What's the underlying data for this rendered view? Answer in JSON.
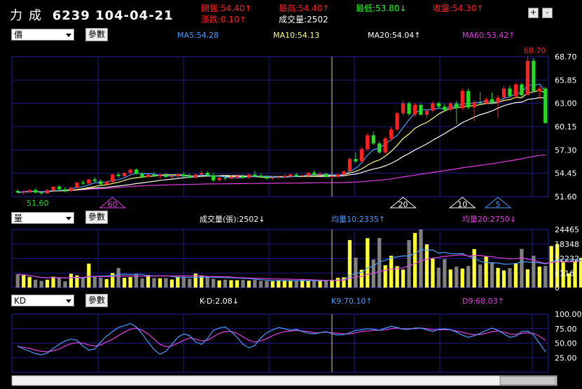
{
  "header": {
    "company": "力成",
    "code_date": "6239 104-04-21",
    "open": "開盤:54.40↑",
    "change": "漲跌:0.10↑",
    "high": "最高:54.40↑",
    "volume": "成交量:2502",
    "low": "最低:53.80↓",
    "close": "收盤:54.30↑",
    "zoom_in": "+",
    "zoom_out": "-"
  },
  "price_panel": {
    "select": "價",
    "button": "參數",
    "ma5": "MA5:54.28",
    "ma10": "MA10:54.13",
    "ma20": "MA20:54.04↑",
    "ma60": "MA60:53.42↑",
    "high_label": "68.70",
    "low_label": "51.60",
    "markers": [
      "60",
      "20",
      "10",
      "5"
    ]
  },
  "volume_panel": {
    "select": "量",
    "button": "參數",
    "vol": "成交量(張):2502↓",
    "avg10": "均量10:2335↑",
    "avg20": "均量20:2750↓"
  },
  "kd_panel": {
    "select": "KD",
    "button": "參數",
    "kd": "K-D:2.08↓",
    "k9": "K9:70.10↑",
    "d9": "D9:68.03↑"
  },
  "colors": {
    "up": "#ff2020",
    "down": "#22dd22",
    "ma5": "#4a9cff",
    "ma10": "#ffff80",
    "ma20": "#ffffff",
    "ma60": "#e040e0",
    "vol_up": "#ffff33",
    "vol_down": "#808080",
    "grid": "#1b1b8a"
  },
  "chart_data": [
    {
      "type": "candlestick",
      "title": "6239 104-04-21",
      "ylim": [
        51.6,
        68.7
      ],
      "yticks": [
        68.7,
        65.85,
        63.0,
        60.15,
        57.3,
        54.45,
        51.6
      ],
      "ohlc": [
        [
          52.3,
          52.5,
          52.0,
          52.1
        ],
        [
          52.1,
          52.4,
          51.9,
          52.2
        ],
        [
          52.2,
          52.5,
          52.0,
          52.4
        ],
        [
          52.4,
          52.6,
          52.0,
          52.1
        ],
        [
          52.1,
          52.3,
          51.8,
          52.0
        ],
        [
          52.0,
          52.5,
          51.9,
          52.4
        ],
        [
          52.4,
          52.9,
          52.2,
          52.8
        ],
        [
          52.8,
          53.0,
          52.4,
          52.5
        ],
        [
          52.5,
          52.8,
          52.1,
          52.3
        ],
        [
          52.3,
          52.8,
          52.2,
          52.7
        ],
        [
          52.7,
          53.4,
          52.6,
          53.3
        ],
        [
          53.3,
          53.6,
          53.0,
          53.2
        ],
        [
          53.2,
          53.8,
          53.1,
          53.7
        ],
        [
          53.7,
          54.0,
          53.3,
          53.5
        ],
        [
          53.5,
          53.7,
          53.0,
          53.1
        ],
        [
          53.1,
          53.5,
          52.9,
          53.4
        ],
        [
          53.4,
          54.4,
          53.3,
          54.3
        ],
        [
          54.3,
          54.6,
          53.9,
          54.1
        ],
        [
          54.1,
          54.6,
          53.8,
          54.5
        ],
        [
          54.5,
          55.0,
          54.2,
          54.9
        ],
        [
          54.9,
          55.0,
          54.3,
          54.4
        ],
        [
          54.4,
          54.6,
          53.9,
          54.0
        ],
        [
          54.0,
          54.5,
          53.9,
          54.3
        ],
        [
          54.3,
          54.6,
          54.0,
          54.1
        ],
        [
          54.1,
          54.4,
          53.8,
          54.2
        ],
        [
          54.2,
          54.5,
          53.9,
          54.0
        ],
        [
          54.0,
          54.3,
          53.8,
          54.1
        ],
        [
          54.1,
          54.5,
          53.9,
          54.3
        ],
        [
          54.3,
          54.6,
          53.9,
          54.1
        ],
        [
          54.1,
          54.4,
          53.8,
          53.9
        ],
        [
          53.9,
          54.4,
          53.8,
          54.3
        ],
        [
          54.3,
          54.8,
          54.1,
          54.5
        ],
        [
          54.5,
          54.7,
          54.0,
          54.2
        ],
        [
          54.2,
          54.5,
          53.4,
          53.6
        ],
        [
          53.6,
          54.0,
          53.4,
          53.9
        ],
        [
          53.9,
          54.2,
          53.6,
          53.8
        ],
        [
          53.8,
          54.2,
          53.7,
          54.0
        ],
        [
          54.0,
          54.3,
          53.8,
          54.1
        ],
        [
          54.1,
          54.3,
          53.8,
          53.9
        ],
        [
          53.9,
          54.4,
          53.8,
          54.3
        ],
        [
          54.3,
          54.8,
          54.0,
          54.1
        ],
        [
          54.1,
          54.4,
          53.9,
          54.0
        ],
        [
          54.0,
          54.2,
          53.7,
          53.8
        ],
        [
          53.8,
          54.1,
          53.6,
          53.9
        ],
        [
          53.9,
          54.2,
          53.7,
          54.0
        ],
        [
          54.0,
          54.3,
          53.9,
          54.1
        ],
        [
          54.1,
          54.4,
          53.9,
          54.3
        ],
        [
          54.3,
          54.5,
          54.0,
          54.1
        ],
        [
          54.1,
          54.3,
          53.9,
          54.2
        ],
        [
          54.2,
          54.6,
          54.0,
          54.5
        ],
        [
          54.5,
          54.8,
          54.2,
          54.3
        ],
        [
          54.3,
          54.6,
          54.1,
          54.4
        ],
        [
          54.4,
          54.5,
          53.9,
          54.0
        ],
        [
          54.0,
          54.2,
          53.8,
          54.1
        ],
        [
          54.1,
          54.4,
          53.9,
          54.3
        ],
        [
          54.3,
          54.8,
          54.2,
          54.7
        ],
        [
          54.7,
          56.4,
          54.6,
          56.2
        ],
        [
          56.2,
          57.0,
          55.7,
          55.9
        ],
        [
          55.9,
          57.6,
          55.8,
          57.4
        ],
        [
          57.4,
          59.3,
          57.2,
          59.1
        ],
        [
          59.1,
          59.6,
          57.9,
          58.1
        ],
        [
          58.1,
          58.3,
          56.8,
          57.0
        ],
        [
          57.0,
          58.9,
          56.8,
          58.7
        ],
        [
          58.7,
          60.1,
          58.4,
          59.8
        ],
        [
          59.8,
          62.0,
          59.6,
          61.8
        ],
        [
          61.8,
          63.4,
          61.5,
          63.0
        ],
        [
          63.0,
          63.2,
          61.5,
          61.7
        ],
        [
          61.7,
          63.0,
          61.4,
          62.8
        ],
        [
          62.8,
          63.0,
          61.5,
          61.6
        ],
        [
          61.6,
          62.3,
          61.2,
          62.1
        ],
        [
          62.1,
          63.3,
          61.9,
          63.0
        ],
        [
          63.0,
          63.2,
          62.4,
          62.6
        ],
        [
          62.6,
          62.9,
          62.0,
          62.2
        ],
        [
          62.2,
          63.2,
          62.0,
          63.0
        ],
        [
          63.0,
          63.3,
          60.5,
          62.4
        ],
        [
          62.4,
          64.8,
          62.2,
          64.5
        ],
        [
          64.5,
          64.8,
          62.3,
          62.5
        ],
        [
          62.5,
          63.4,
          60.8,
          63.1
        ],
        [
          63.1,
          64.4,
          62.8,
          63.0
        ],
        [
          63.0,
          63.7,
          62.9,
          63.5
        ],
        [
          63.5,
          64.3,
          63.1,
          63.1
        ],
        [
          63.1,
          64.0,
          61.2,
          63.7
        ],
        [
          63.7,
          65.1,
          63.4,
          64.8
        ],
        [
          64.8,
          65.2,
          63.7,
          63.9
        ],
        [
          63.9,
          65.5,
          63.6,
          65.3
        ],
        [
          65.3,
          65.5,
          63.8,
          64.0
        ],
        [
          64.0,
          68.7,
          64.0,
          68.2
        ],
        [
          68.2,
          68.5,
          64.3,
          64.5
        ],
        [
          64.5,
          65.1,
          63.5,
          64.8
        ],
        [
          64.8,
          65.0,
          60.5,
          60.6
        ]
      ]
    },
    {
      "type": "bar",
      "title": "成交量(張)",
      "ylim": [
        0,
        24465
      ],
      "yticks": [
        24465,
        18348,
        12232,
        6116,
        0
      ],
      "values": [
        5600,
        5200,
        4500,
        3300,
        2800,
        3300,
        4600,
        4100,
        2600,
        5800,
        5100,
        4100,
        10100,
        4700,
        4200,
        3600,
        6100,
        8200,
        4100,
        4400,
        5800,
        3800,
        5300,
        4000,
        3900,
        4000,
        3400,
        4600,
        4300,
        3700,
        5900,
        5100,
        4800,
        3700,
        3000,
        3300,
        3100,
        3100,
        3200,
        2900,
        3200,
        2800,
        2800,
        2700,
        2800,
        2900,
        3000,
        2800,
        3200,
        2800,
        3200,
        3100,
        3100,
        3200,
        4100,
        4300,
        20000,
        12600,
        7500,
        20800,
        11800,
        20900,
        9400,
        13400,
        9000,
        7600,
        20000,
        23000,
        24465,
        18200,
        12200,
        8400,
        12000,
        7600,
        8800,
        8000,
        9100,
        16200,
        9700,
        13100,
        10700,
        8300,
        7200,
        8200,
        10300,
        16300,
        7700,
        13400,
        8800,
        9100,
        17500,
        18348,
        10700,
        6000,
        11100,
        12500
      ]
    },
    {
      "type": "line",
      "title": "KD",
      "ylim": [
        0,
        100
      ],
      "yticks": [
        100.0,
        75.0,
        50.0,
        25.0
      ],
      "series": [
        {
          "name": "K9",
          "values": [
            45,
            40,
            36,
            32,
            30,
            33,
            41,
            48,
            54,
            57,
            55,
            45,
            38,
            40,
            52,
            62,
            70,
            77,
            80,
            84,
            78,
            66,
            52,
            39,
            31,
            36,
            48,
            60,
            66,
            63,
            52,
            48,
            58,
            72,
            76,
            78,
            70,
            60,
            48,
            42,
            46,
            59,
            68,
            73,
            77,
            75,
            72,
            74,
            70,
            67,
            66,
            68,
            70,
            66,
            64,
            65,
            68,
            72,
            73,
            75,
            74,
            72,
            76,
            79,
            77,
            74,
            74,
            76,
            76,
            73,
            70,
            74,
            75,
            73,
            69,
            64,
            60,
            63,
            67,
            72,
            76,
            72,
            66,
            60,
            62,
            70,
            71,
            64,
            50,
            35
          ]
        },
        {
          "name": "D9",
          "values": [
            44,
            43,
            41,
            38,
            36,
            35,
            37,
            40,
            45,
            49,
            51,
            50,
            47,
            45,
            47,
            52,
            57,
            63,
            69,
            74,
            76,
            72,
            66,
            57,
            48,
            44,
            45,
            50,
            55,
            59,
            57,
            54,
            55,
            61,
            67,
            70,
            70,
            67,
            61,
            55,
            52,
            54,
            58,
            63,
            67,
            70,
            71,
            72,
            71,
            70,
            68,
            68,
            69,
            68,
            67,
            66,
            66,
            68,
            70,
            71,
            72,
            72,
            73,
            75,
            76,
            75,
            75,
            75,
            76,
            75,
            73,
            73,
            73,
            73,
            71,
            69,
            66,
            65,
            65,
            67,
            70,
            71,
            69,
            66,
            65,
            67,
            68,
            67,
            62,
            55
          ]
        }
      ]
    }
  ]
}
